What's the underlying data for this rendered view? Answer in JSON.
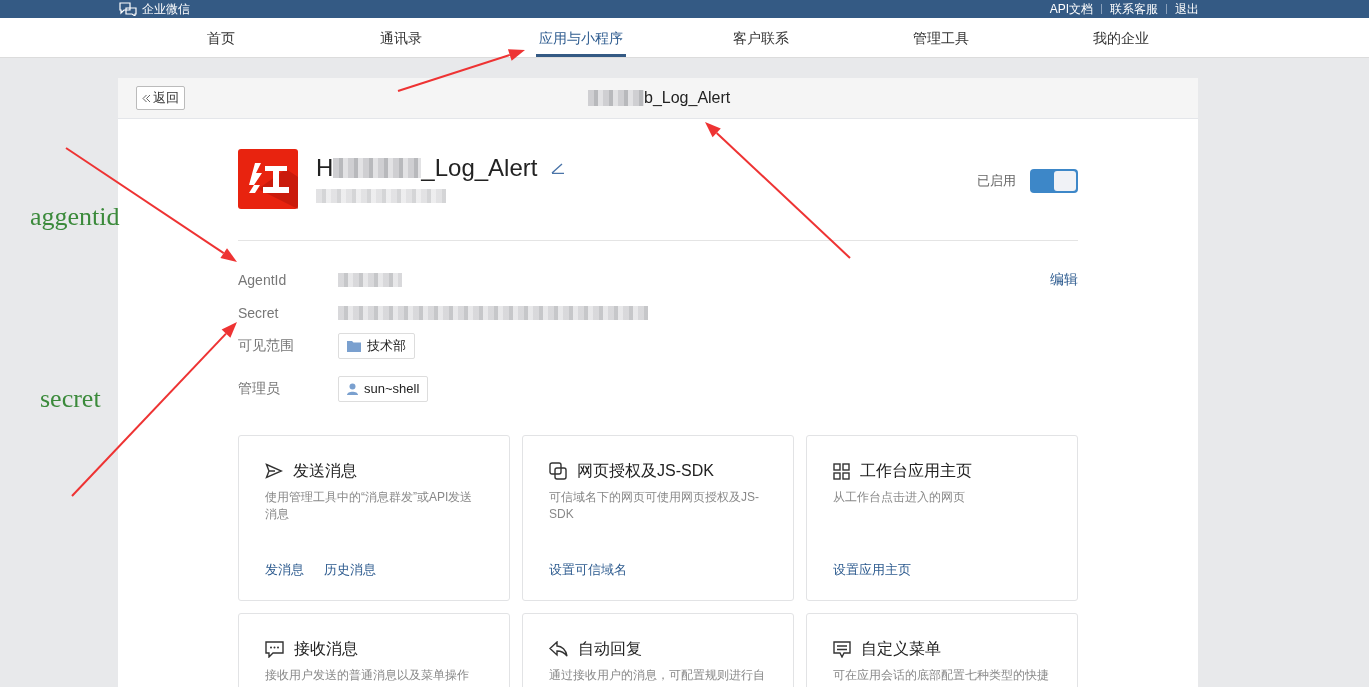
{
  "top_bar": {
    "logo_text": "企业微信",
    "links": [
      "API文档",
      "联系客服",
      "退出"
    ]
  },
  "nav": [
    {
      "label": "首页",
      "selected": false
    },
    {
      "label": "通讯录",
      "selected": false
    },
    {
      "label": "应用与小程序",
      "selected": true
    },
    {
      "label": "客户联系",
      "selected": false
    },
    {
      "label": "管理工具",
      "selected": false
    },
    {
      "label": "我的企业",
      "selected": false
    }
  ],
  "panel": {
    "back_button": "返回",
    "title": "b_Log_Alert"
  },
  "app": {
    "name_prefix": "H",
    "name_suffix": "_Log_Alert",
    "status_label": "已启用",
    "enabled": true
  },
  "edit_link": "编辑",
  "details": [
    {
      "kind": "hidden",
      "label": "AgentId"
    },
    {
      "kind": "hidden",
      "label": "Secret"
    },
    {
      "kind": "department",
      "label": "可见范围",
      "value": "技术部"
    },
    {
      "kind": "member",
      "label": "管理员",
      "value": "sun~shell"
    }
  ],
  "cards": [
    {
      "kind": "send",
      "title": "发送消息",
      "description": "使用管理工具中的“消息群发”或API发送消息",
      "links": [
        "发消息",
        "历史消息"
      ]
    },
    {
      "kind": "web",
      "title": "网页授权及JS-SDK",
      "description": "可信域名下的网页可使用网页授权及JS-SDK",
      "links": [
        "设置可信域名"
      ]
    },
    {
      "kind": "workbench",
      "title": "工作台应用主页",
      "description": "从工作台点击进入的网页",
      "links": [
        "设置应用主页"
      ]
    },
    {
      "kind": "receive",
      "title": "接收消息",
      "description": "接收用户发送的普通消息以及菜单操作"
    },
    {
      "kind": "reply",
      "title": "自动回复",
      "description": "通过接收用户的消息，可配置规则进行自"
    },
    {
      "kind": "menu",
      "title": "自定义菜单",
      "description": "可在应用会话的底部配置七种类型的快捷"
    }
  ],
  "annotations": [
    {
      "text": "aggentid"
    },
    {
      "text": "secret"
    }
  ]
}
